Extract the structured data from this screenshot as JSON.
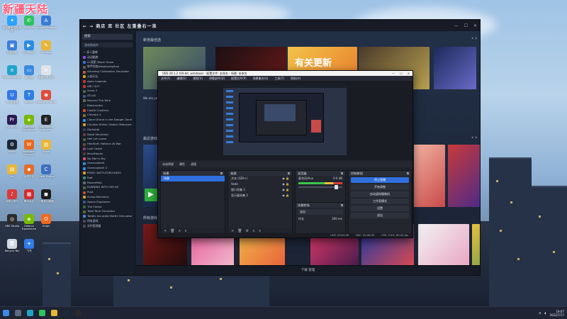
{
  "watermark": "新疆天陆",
  "desktop": {
    "icons": [
      {
        "label": "电脑管家-垃圾清理",
        "color": "#2aa3ff",
        "glyph": "✦"
      },
      {
        "label": "WeChat",
        "color": "#2dc35f",
        "glyph": "✆"
      },
      {
        "label": "Acrobat Reader",
        "color": "#3a7bd5",
        "glyph": "A"
      },
      {
        "label": "控制面板",
        "color": "#3c7fd9",
        "glyph": "▣"
      },
      {
        "label": "QQ Player",
        "color": "#2f8be0",
        "glyph": "▶"
      },
      {
        "label": "Notepad",
        "color": "#e8b636",
        "glyph": "✎"
      },
      {
        "label": "Microsoft Edge",
        "color": "#1fa4c9",
        "glyph": "e"
      },
      {
        "label": "此电脑",
        "color": "#3b8be0",
        "glyph": "▭"
      },
      {
        "label": "新建文本文档",
        "color": "#dfe4ea",
        "glyph": "≡"
      },
      {
        "label": "UU 加速器",
        "color": "#3477e8",
        "glyph": "U"
      },
      {
        "label": "ToDesk",
        "color": "#2f7fe0",
        "glyph": "T"
      },
      {
        "label": "Google Chrome",
        "color": "#e24a3a",
        "glyph": "◉"
      },
      {
        "label": "Premiere",
        "color": "#2a1a55",
        "glyph": "Pr"
      },
      {
        "label": "Geforce Experience",
        "color": "#76b900",
        "glyph": "◈"
      },
      {
        "label": "Epic Games Launcher",
        "color": "#222",
        "glyph": "E"
      },
      {
        "label": "Steam",
        "color": "#1b2838",
        "glyph": "⚙"
      },
      {
        "label": "Wallpaper Engine",
        "color": "#e86a1c",
        "glyph": "W"
      },
      {
        "label": "Game",
        "color": "#e8b636",
        "glyph": "▤"
      },
      {
        "label": "Tool",
        "color": "#e8b636",
        "glyph": "▤"
      },
      {
        "label": "火绒安全",
        "color": "#e56b2b",
        "glyph": "◆"
      },
      {
        "label": "Cheat Engine",
        "color": "#3f6fbf",
        "glyph": "C"
      },
      {
        "label": "网易云音乐",
        "color": "#d93a3a",
        "glyph": "♪"
      },
      {
        "label": "腾讯会议",
        "color": "#d22d2d",
        "glyph": "▦"
      },
      {
        "label": "小黑盒加速器",
        "color": "#1c1c1c",
        "glyph": "◼"
      },
      {
        "label": "OBS Studio",
        "color": "#2b2b2b",
        "glyph": "◎"
      },
      {
        "label": "Geforce Experience",
        "color": "#76b900",
        "glyph": "◈"
      },
      {
        "label": "Origin",
        "color": "#f06b1f",
        "glyph": "O"
      },
      {
        "label": "Recycle Bin",
        "color": "#cfd8e3",
        "glyph": "🗑"
      },
      {
        "label": "飞书",
        "color": "#2f7be8",
        "glyph": "✈"
      }
    ]
  },
  "steam": {
    "nav": "← → 商店 库 社区 左重叠右一准",
    "search_placeholder": "搜索",
    "filter": "游戏和软件",
    "library_header": "一 多人游戏",
    "games": [
      {
        "name": "动动酷跑",
        "c": "#8a4bd8"
      },
      {
        "name": "Ai 搜索 Warm Snow",
        "c": "#3a6fc8"
      },
      {
        "name": "铁甲烈焰AdsplayingSoul",
        "c": "#5a5a5a"
      },
      {
        "name": "Amazing Cultivation Simulator",
        "c": "#c45a2a"
      },
      {
        "name": "火焰天坛",
        "c": "#d89a2a"
      },
      {
        "name": "Apex Legends",
        "c": "#c4382a"
      },
      {
        "name": "ARC OUT",
        "c": "#c4382a"
      },
      {
        "name": "Arma 3",
        "c": "#4a6a3a"
      },
      {
        "name": "ATLAS",
        "c": "#3a5a8a"
      },
      {
        "name": "Beyond The Wire",
        "c": "#6a6a4a"
      },
      {
        "name": "Blackmetro",
        "c": "#2a2a2a"
      },
      {
        "name": "Castle Crashers",
        "c": "#d84a2a"
      },
      {
        "name": "Chivalry 2",
        "c": "#8a6a3a"
      },
      {
        "name": "Clone Drone in the Danger Zone",
        "c": "#3a8ad8"
      },
      {
        "name": "Counter-Strike: Global Offensive",
        "c": "#d8a02a"
      },
      {
        "name": "Darkside",
        "c": "#3a3a5a"
      },
      {
        "name": "Dead Simulator",
        "c": "#6a3a3a"
      },
      {
        "name": "Hell Let Loose",
        "c": "#5a5a3a"
      },
      {
        "name": "HoldSoft: Nations At War",
        "c": "#6a4a2a"
      },
      {
        "name": "Lost Castle",
        "c": "#8a3a6a"
      },
      {
        "name": "MordHauler",
        "c": "#5a3a2a"
      },
      {
        "name": "No Man's Sky",
        "c": "#d84a6a"
      },
      {
        "name": "Overcooked!",
        "c": "#3a8ad8"
      },
      {
        "name": "Overcooked! 2",
        "c": "#3a8ad8"
      },
      {
        "name": "PUBG: BATTLEGROUNDS",
        "c": "#d8a02a"
      },
      {
        "name": "Raft",
        "c": "#3a8a6a"
      },
      {
        "name": "Ravenfield",
        "c": "#6a6a6a"
      },
      {
        "name": "RUNNING WITH RIFLES",
        "c": "#4a6a3a"
      },
      {
        "name": "Rust",
        "c": "#c44a2a"
      },
      {
        "name": "Scrap Mechanic",
        "c": "#d8a02a"
      },
      {
        "name": "Space Engineers",
        "c": "#3a5a8a"
      },
      {
        "name": "The Forest",
        "c": "#3a6a3a"
      },
      {
        "name": "Total Tank Simulator",
        "c": "#5a6a3a"
      },
      {
        "name": "Totally Accurate Battle Simulator",
        "c": "#3a8ad8"
      },
      {
        "name": "所有游戏",
        "c": "#4a4a5a"
      },
      {
        "name": "文件管理器",
        "c": "#4a4a5a"
      }
    ],
    "sections": {
      "new": "新增最佳选",
      "recent": "最近游戏",
      "all": "所有游戏"
    },
    "new_game_caption": "We are proud to...",
    "bottom": "下载 管理",
    "tile_text_update": "有关更新"
  },
  "obs": {
    "title": "OBS 28.1.2 (64-bit, windows) - 配置文件: 未命名 - 场景: 未命名",
    "menu": [
      "文件(F)",
      "编辑(E)",
      "视图(V)",
      "停靠部件(D)",
      "配置文件(P)",
      "场景集合(S)",
      "工具(T)",
      "帮助(H)"
    ],
    "srcbar": [
      "未选择源",
      "属性",
      "滤镜"
    ],
    "docks": {
      "scenes": {
        "title": "场景",
        "items": [
          "场景"
        ]
      },
      "sources": {
        "title": "来源",
        "items": [
          "文本 (GDI+)",
          "Vodo",
          "窗口采集 2",
          "显示器采集 2"
        ]
      },
      "mixer": {
        "title": "混音器",
        "track": "麦克风/Aux",
        "level": "0.0 dB"
      },
      "transitions": {
        "title": "场景转场",
        "type": "淡出",
        "duration_label": "时长",
        "duration": "300 ms"
      },
      "controls": {
        "title": "控制按钮",
        "buttons": [
          "停止直播",
          "开始录制",
          "启动虚拟摄像机",
          "工作室模式",
          "设置",
          "退出"
        ]
      }
    },
    "status": [
      "LIVE: 00:00:00",
      "REC: 00:00:00",
      "CPU: 0.5%, 60.00 fps"
    ]
  },
  "taskbar": {
    "time": "19:07",
    "date": "2022/7/17"
  }
}
